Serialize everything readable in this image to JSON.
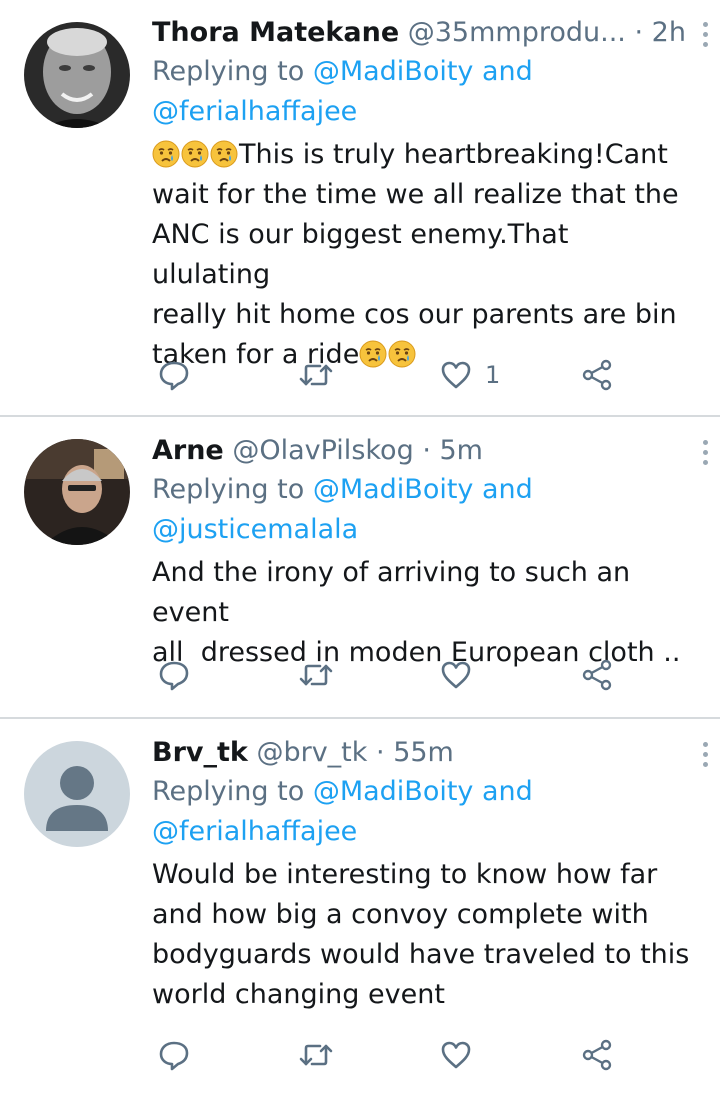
{
  "tweets": [
    {
      "name": "Thora Matekane",
      "handle": "@35mmprodu...",
      "dot": "·",
      "time": "2h",
      "replying_prefix": "Replying to ",
      "replying_mention1": "@MadiBoity",
      "replying_and": " and",
      "replying_mention2": "@ferialhaffajee",
      "text_line1": "This is truly heartbreaking!Cant",
      "text_line2": "wait for the time we all realize that the",
      "text_line3": "ANC is our biggest enemy.That ululating",
      "text_line4": "really hit home cos our parents are bin",
      "text_line5": "taken for a ride",
      "likes": "1"
    },
    {
      "name": "Arne",
      "handle": "@OlavPilskog",
      "dot": "·",
      "time": "5m",
      "replying_prefix": "Replying to ",
      "replying_mention1": "@MadiBoity",
      "replying_and": " and",
      "replying_mention2": "@justicemalala",
      "text_line1": "And the irony of arriving to such an event",
      "text_line2": "all  dressed in moden European cloth .."
    },
    {
      "name": "Brv_tk",
      "handle": "@brv_tk",
      "dot": "·",
      "time": "55m",
      "replying_prefix": "Replying to ",
      "replying_mention1": "@MadiBoity",
      "replying_and": " and",
      "replying_mention2": "@ferialhaffajee",
      "text_line1": "Would be interesting to know how far",
      "text_line2": "and how big a convoy complete with",
      "text_line3": "bodyguards would have traveled to this",
      "text_line4": "world changing event"
    }
  ],
  "colors": {
    "accent": "#1da1f2",
    "secondary": "#5b7083",
    "text": "#14171a",
    "divider": "#d6dadd"
  },
  "icons": [
    "reply-icon",
    "retweet-icon",
    "like-icon",
    "share-icon",
    "more-icon",
    "crying-face-emoji"
  ]
}
